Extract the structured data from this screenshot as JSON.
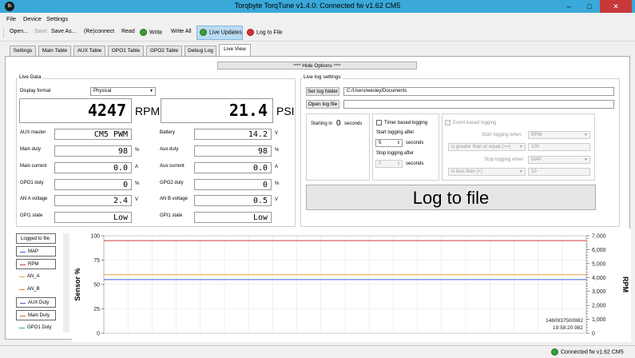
{
  "window": {
    "title": "Torqbyte TorqTune v1.4.0:  Connected fw v1.62 CM5",
    "icon_text": "tb",
    "minimize": "–",
    "maximize": "□",
    "close": "✕"
  },
  "menu": [
    "File",
    "Device",
    "Settings"
  ],
  "toolbar": {
    "open": "Open...",
    "save": "Save",
    "save_as": "Save As...",
    "reconnect": "(Re)connect",
    "read": "Read",
    "write": "Write",
    "write_all": "Write All",
    "live_updates": "Live Updates",
    "log_to_file": "Log to File"
  },
  "tabs": [
    "Settings",
    "Main Table",
    "AUX Table",
    "GPO1 Table",
    "GPO2 Table",
    "Debug Log",
    "Live View"
  ],
  "hide_options": "^^^ Hide Options ^^^",
  "live_data": {
    "title": "Live Data",
    "display_format_label": "Display format",
    "display_format_value": "Physical",
    "rpm_value": "4247",
    "rpm_unit": "RPM",
    "psi_value": "21.4",
    "psi_unit": "PSI",
    "rows": [
      {
        "l_label": "AUX master",
        "l_value": "CM5 PWM",
        "l_unit": "",
        "r_label": "Battery",
        "r_value": "14.2",
        "r_unit": "V"
      },
      {
        "l_label": "Main duty",
        "l_value": "98",
        "l_unit": "%",
        "r_label": "Aux duty",
        "r_value": "98",
        "r_unit": "%"
      },
      {
        "l_label": "Main current",
        "l_value": "0.0",
        "l_unit": "A",
        "r_label": "Aux current",
        "r_value": "0.0",
        "r_unit": "A"
      },
      {
        "l_label": "GPO1 duty",
        "l_value": "0",
        "l_unit": "%",
        "r_label": "GPO2 duty",
        "r_value": "0",
        "r_unit": "%"
      },
      {
        "l_label": "AN A voltage",
        "l_value": "2.4",
        "l_unit": "V",
        "r_label": "AN B voltage",
        "r_value": "0.5",
        "r_unit": "V"
      },
      {
        "l_label": "GPI1 state",
        "l_value": "Low",
        "l_unit": "",
        "r_label": "GPI1 state",
        "r_value": "Low",
        "r_unit": ""
      }
    ]
  },
  "log_settings": {
    "title": "Live log settings",
    "set_folder_btn": "Set log folder",
    "folder_path": "C:/Users/wesley/Documents",
    "open_log_btn": "Open log file",
    "open_log_path": "",
    "starting_in": "Starting in",
    "starting_value": "0",
    "seconds": "seconds",
    "timer_based": "Timer based logging",
    "start_after": "Start logging after",
    "start_value": "5",
    "start_unit": "seconds",
    "stop_after": "Stop logging after",
    "stop_value": "0",
    "stop_unit": "seconds",
    "event_based": "Event based logging",
    "start_when": "Start logging when",
    "start_when_value": "RPM",
    "cond1": "is greater than or equal (>=)",
    "cond1_value": "100",
    "stop_when": "Stop logging when",
    "stop_when_value": "MAP",
    "cond2": "is less than (<)",
    "cond2_value": "10",
    "log_button": "Log to file"
  },
  "legend": [
    {
      "label": "Logged to file",
      "color": "",
      "boxed": true
    },
    {
      "label": "MAP",
      "color": "#3b5bd6",
      "boxed": true
    },
    {
      "label": "RPM",
      "color": "#d23c3c",
      "boxed": true
    },
    {
      "label": "AN_A",
      "color": "#e8a030",
      "boxed": false
    },
    {
      "label": "AN_B",
      "color": "#e07a20",
      "boxed": false
    },
    {
      "label": "AUX Duty",
      "color": "#7a4fb0",
      "boxed": true
    },
    {
      "label": "Main Duty",
      "color": "#d86a2a",
      "boxed": true
    },
    {
      "label": "GPO1 Duty",
      "color": "#2fb36a",
      "boxed": false
    }
  ],
  "chart_data": {
    "type": "line",
    "ylabel": "Sensor %",
    "y2label": "RPM",
    "ylim": [
      0,
      100
    ],
    "y2lim": [
      0,
      7000
    ],
    "yticks": [
      0,
      25,
      50,
      75,
      100
    ],
    "y2ticks": [
      "0",
      "1,000",
      "2,000",
      "3,000",
      "4,000",
      "5,000",
      "6,000",
      "7,000"
    ],
    "series": [
      {
        "name": "RPM",
        "color": "#d23c3c",
        "axis": "right",
        "values": [
          6650,
          6650,
          6650,
          6650,
          6650
        ]
      },
      {
        "name": "MAP",
        "color": "#3b5bd6",
        "axis": "left",
        "values": [
          55,
          55,
          55,
          55,
          55
        ]
      },
      {
        "name": "AN_A",
        "color": "#e8a030",
        "axis": "left",
        "values": [
          60,
          60,
          60,
          60,
          60
        ]
      }
    ],
    "time_label_1": "1460937500982",
    "time_label_2": "19:58:20.982"
  },
  "status": {
    "text": "Connected fw v1.62 CM5",
    "color": "#3c9a33"
  }
}
